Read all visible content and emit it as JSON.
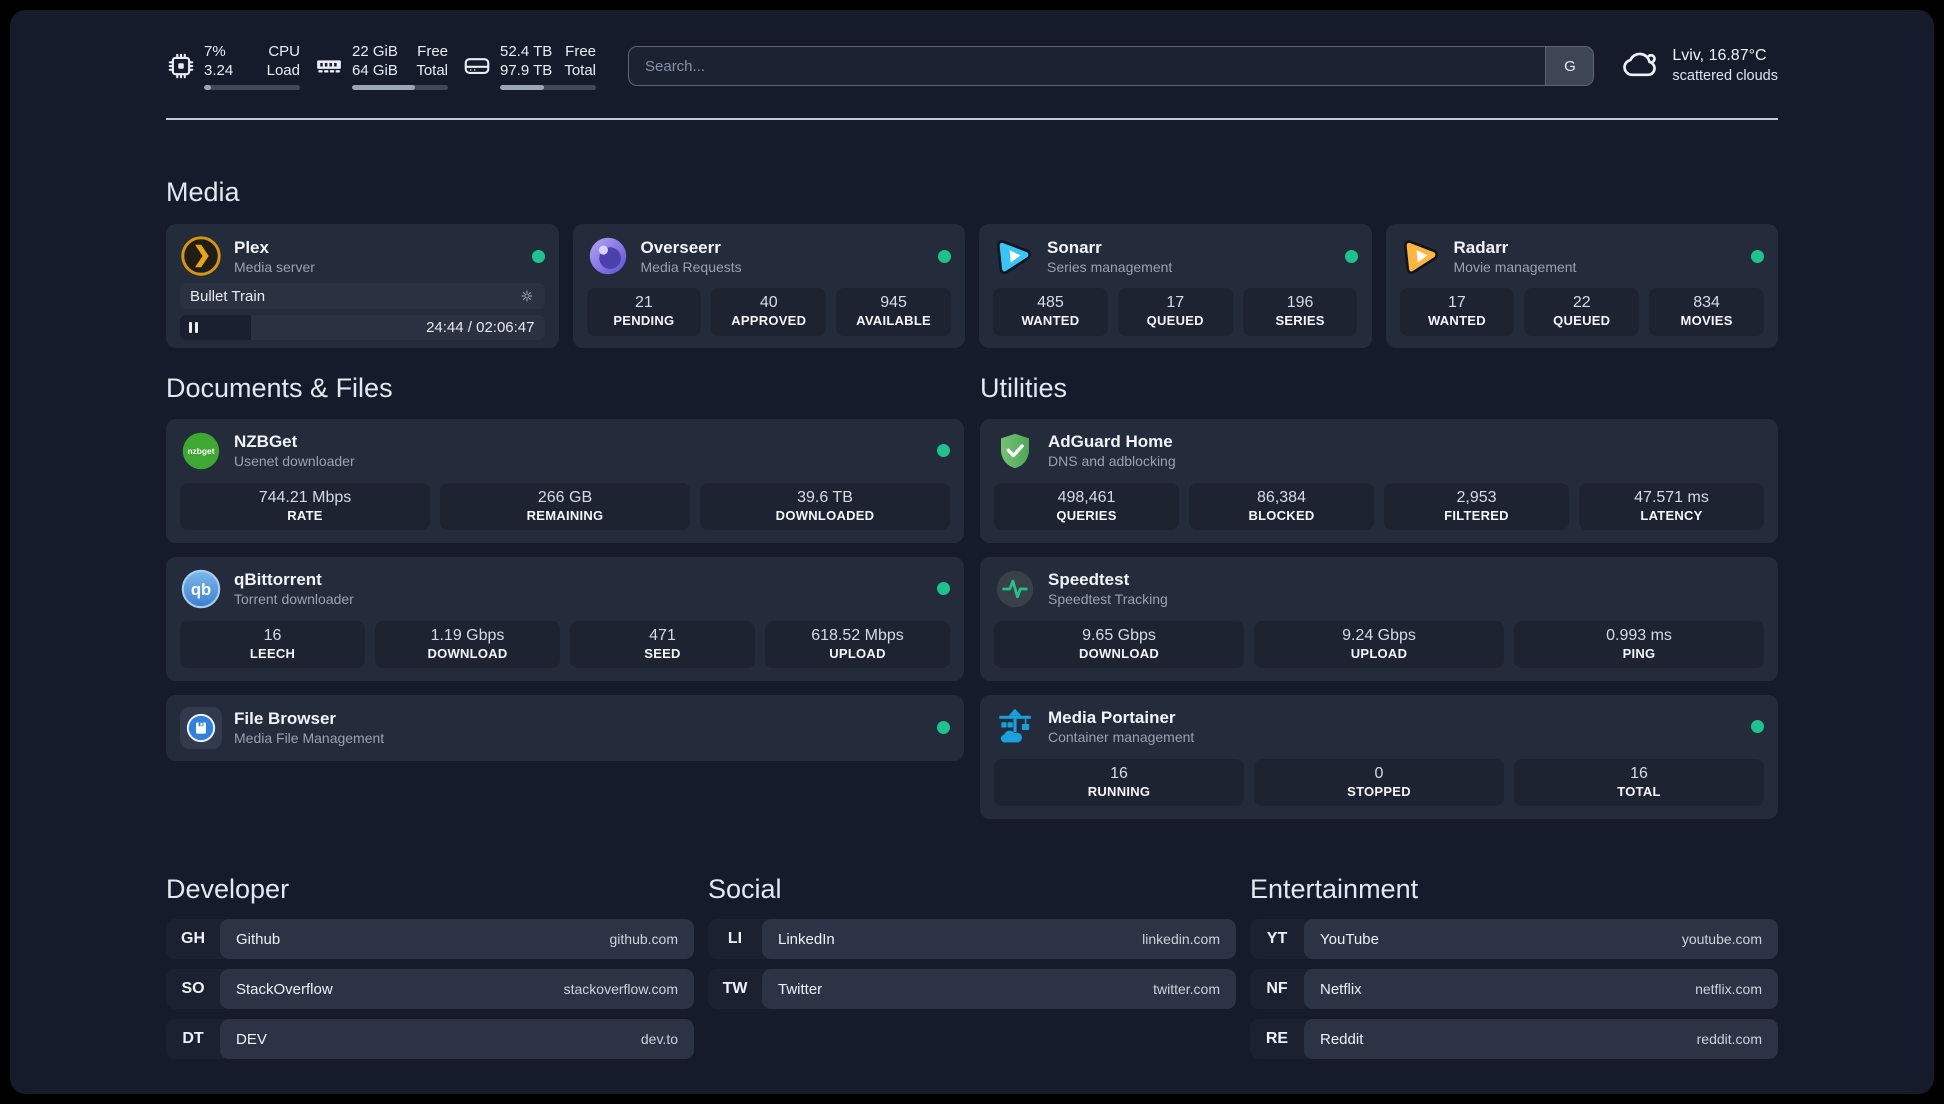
{
  "colors": {
    "status-green": "#1ec28d",
    "page-bg": "#161b2b",
    "card-bg": "#242b3a",
    "pill-bg": "#1d2331",
    "bar-fill": "#9aa5b6"
  },
  "header": {
    "stats": [
      {
        "name": "cpu",
        "value_top": "7%",
        "value_bottom": "3.24",
        "label_top": "CPU",
        "label_bottom": "Load",
        "progress_pct": 7
      },
      {
        "name": "memory",
        "value_top": "22 GiB",
        "value_bottom": "64 GiB",
        "label_top": "Free",
        "label_bottom": "Total",
        "progress_pct": 66
      },
      {
        "name": "disk",
        "value_top": "52.4 TB",
        "value_bottom": "97.9 TB",
        "label_top": "Free",
        "label_bottom": "Total",
        "progress_pct": 46
      }
    ],
    "search": {
      "placeholder": "Search...",
      "engine_label": "G"
    },
    "weather": {
      "location_temp": "Lviv, 16.87°C",
      "condition": "scattered clouds"
    }
  },
  "sections": {
    "media": {
      "title": "Media",
      "cards": {
        "plex": {
          "name": "Plex",
          "subtitle": "Media server",
          "online": true,
          "now_playing": {
            "title": "Bullet Train",
            "time_display": "24:44 / 02:06:47",
            "progress_pct": 19.5
          }
        },
        "overseerr": {
          "name": "Overseerr",
          "subtitle": "Media Requests",
          "online": true,
          "stats": [
            {
              "value": "21",
              "label": "PENDING"
            },
            {
              "value": "40",
              "label": "APPROVED"
            },
            {
              "value": "945",
              "label": "AVAILABLE"
            }
          ]
        },
        "sonarr": {
          "name": "Sonarr",
          "subtitle": "Series management",
          "online": true,
          "stats": [
            {
              "value": "485",
              "label": "WANTED"
            },
            {
              "value": "17",
              "label": "QUEUED"
            },
            {
              "value": "196",
              "label": "SERIES"
            }
          ]
        },
        "radarr": {
          "name": "Radarr",
          "subtitle": "Movie management",
          "online": true,
          "stats": [
            {
              "value": "17",
              "label": "WANTED"
            },
            {
              "value": "22",
              "label": "QUEUED"
            },
            {
              "value": "834",
              "label": "MOVIES"
            }
          ]
        }
      }
    },
    "documents": {
      "title": "Documents & Files",
      "cards": {
        "nzbget": {
          "name": "NZBGet",
          "subtitle": "Usenet downloader",
          "online": true,
          "stats": [
            {
              "value": "744.21 Mbps",
              "label": "RATE"
            },
            {
              "value": "266 GB",
              "label": "REMAINING"
            },
            {
              "value": "39.6 TB",
              "label": "DOWNLOADED"
            }
          ]
        },
        "qbittorrent": {
          "name": "qBittorrent",
          "subtitle": "Torrent downloader",
          "online": true,
          "stats": [
            {
              "value": "16",
              "label": "LEECH"
            },
            {
              "value": "1.19 Gbps",
              "label": "DOWNLOAD"
            },
            {
              "value": "471",
              "label": "SEED"
            },
            {
              "value": "618.52 Mbps",
              "label": "UPLOAD"
            }
          ]
        },
        "filebrowser": {
          "name": "File Browser",
          "subtitle": "Media File Management",
          "online": true
        }
      }
    },
    "utilities": {
      "title": "Utilities",
      "cards": {
        "adguard": {
          "name": "AdGuard Home",
          "subtitle": "DNS and adblocking",
          "stats": [
            {
              "value": "498,461",
              "label": "QUERIES"
            },
            {
              "value": "86,384",
              "label": "BLOCKED"
            },
            {
              "value": "2,953",
              "label": "FILTERED"
            },
            {
              "value": "47.571 ms",
              "label": "LATENCY"
            }
          ]
        },
        "speedtest": {
          "name": "Speedtest",
          "subtitle": "Speedtest Tracking",
          "stats": [
            {
              "value": "9.65 Gbps",
              "label": "DOWNLOAD"
            },
            {
              "value": "9.24 Gbps",
              "label": "UPLOAD"
            },
            {
              "value": "0.993 ms",
              "label": "PING"
            }
          ]
        },
        "portainer": {
          "name": "Media Portainer",
          "subtitle": "Container management",
          "online": true,
          "stats": [
            {
              "value": "16",
              "label": "RUNNING"
            },
            {
              "value": "0",
              "label": "STOPPED"
            },
            {
              "value": "16",
              "label": "TOTAL"
            }
          ]
        }
      }
    },
    "links": [
      {
        "title": "Developer",
        "items": [
          {
            "abbr": "GH",
            "name": "Github",
            "url": "github.com"
          },
          {
            "abbr": "SO",
            "name": "StackOverflow",
            "url": "stackoverflow.com"
          },
          {
            "abbr": "DT",
            "name": "DEV",
            "url": "dev.to"
          }
        ]
      },
      {
        "title": "Social",
        "items": [
          {
            "abbr": "LI",
            "name": "LinkedIn",
            "url": "linkedin.com"
          },
          {
            "abbr": "TW",
            "name": "Twitter",
            "url": "twitter.com"
          }
        ]
      },
      {
        "title": "Entertainment",
        "items": [
          {
            "abbr": "YT",
            "name": "YouTube",
            "url": "youtube.com"
          },
          {
            "abbr": "NF",
            "name": "Netflix",
            "url": "netflix.com"
          },
          {
            "abbr": "RE",
            "name": "Reddit",
            "url": "reddit.com"
          }
        ]
      }
    ]
  }
}
